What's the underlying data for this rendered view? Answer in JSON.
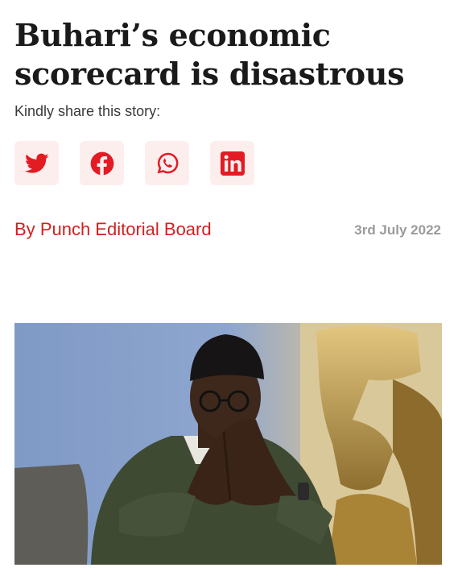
{
  "article": {
    "headline": "Buhari’s economic scorecard is disastrous",
    "share_label": "Kindly share this story:",
    "byline_prefix": "By",
    "author": "Punch Editorial Board",
    "date": "3rd July 2022"
  },
  "share_buttons": [
    {
      "icon": "twitter-icon"
    },
    {
      "icon": "facebook-icon"
    },
    {
      "icon": "whatsapp-icon"
    },
    {
      "icon": "linkedin-icon"
    }
  ],
  "colors": {
    "accent": "#e31b23",
    "byline": "#d21f1f",
    "share_bg": "#fdeeee",
    "date": "#9b9b9b"
  }
}
